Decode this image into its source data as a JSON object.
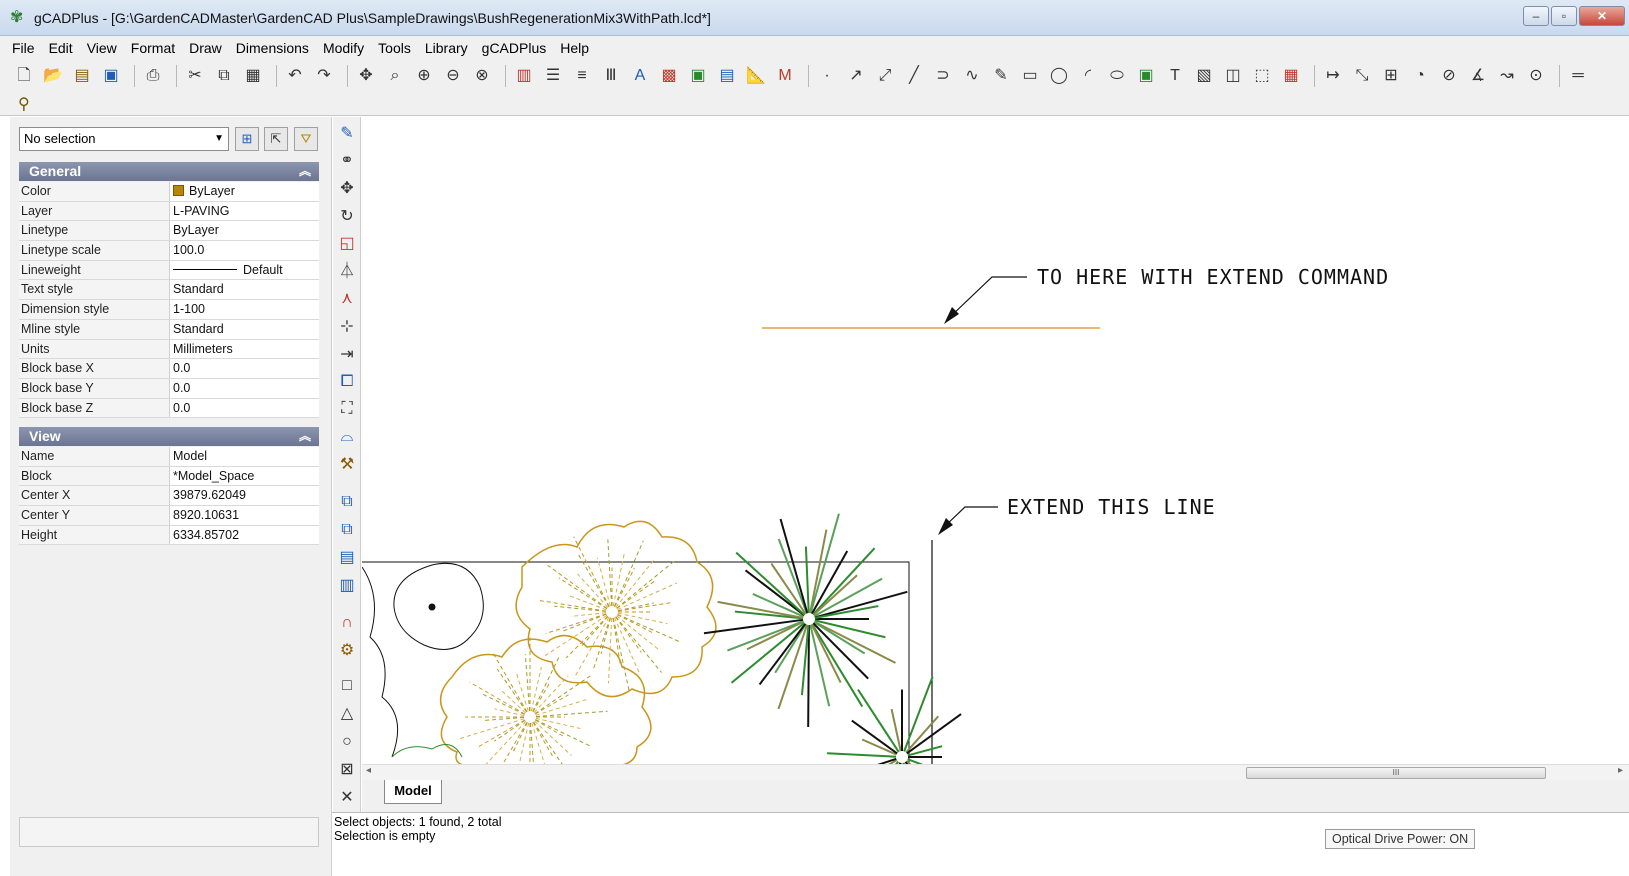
{
  "window": {
    "title": "gCADPlus - [G:\\GardenCADMaster\\GardenCAD Plus\\SampleDrawings\\BushRegenerationMix3WithPath.lcd*]",
    "buttons": {
      "minimize": "–",
      "maximize": "▫",
      "close": "✕"
    }
  },
  "menu": [
    "File",
    "Edit",
    "View",
    "Format",
    "Draw",
    "Dimensions",
    "Modify",
    "Tools",
    "Library",
    "gCADPlus",
    "Help"
  ],
  "properties": {
    "selection": "No selection",
    "general": {
      "header": "General",
      "rows": [
        {
          "name": "Color",
          "value": "ByLayer"
        },
        {
          "name": "Layer",
          "value": "L-PAVING"
        },
        {
          "name": "Linetype",
          "value": "ByLayer"
        },
        {
          "name": "Linetype scale",
          "value": "100.0"
        },
        {
          "name": "Lineweight",
          "value": "Default"
        },
        {
          "name": "Text style",
          "value": "Standard"
        },
        {
          "name": "Dimension style",
          "value": "1-100"
        },
        {
          "name": "Mline style",
          "value": "Standard"
        },
        {
          "name": "Units",
          "value": "Millimeters"
        },
        {
          "name": "Block base X",
          "value": "0.0"
        },
        {
          "name": "Block base Y",
          "value": "0.0"
        },
        {
          "name": "Block base Z",
          "value": "0.0"
        }
      ]
    },
    "view": {
      "header": "View",
      "rows": [
        {
          "name": "Name",
          "value": "Model"
        },
        {
          "name": "Block",
          "value": "*Model_Space"
        },
        {
          "name": "Center X",
          "value": "39879.62049"
        },
        {
          "name": "Center Y",
          "value": "8920.10631"
        },
        {
          "name": "Height",
          "value": "6334.85702"
        }
      ]
    }
  },
  "drawing": {
    "annotation_top": "TO HERE WITH EXTEND COMMAND",
    "annotation_bottom": "EXTEND THIS LINE"
  },
  "tabs": {
    "model": "Model"
  },
  "scrollbar": {
    "grip": "III"
  },
  "command": {
    "line1": "Select objects: 1 found,  2 total",
    "line2": "Selection is empty"
  },
  "tooltip": "Optical Drive Power: ON",
  "colors": {
    "title_gradient": "#c9d9ee",
    "section_header": "#7a839e",
    "bylayer_swatch": "#b8860b",
    "plant_gold": "#c9961a",
    "plant_green": "#2e8b2e",
    "plant_olive": "#8a8a4a",
    "extend_target_line": "#e0a040"
  }
}
